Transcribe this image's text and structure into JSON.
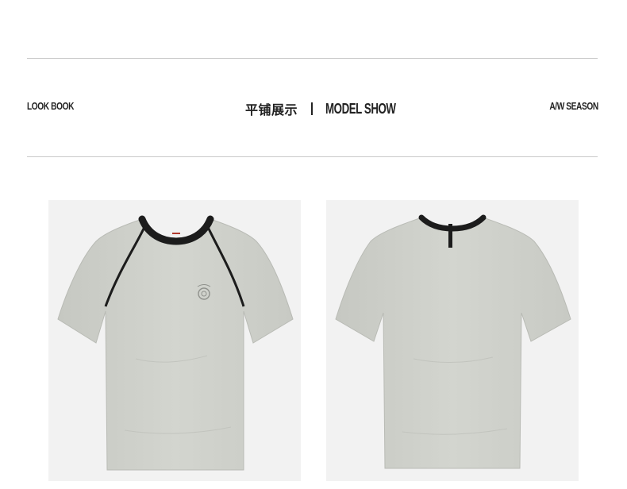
{
  "header": {
    "left_label": "LOOK BOOK",
    "center_cn": "平铺展示",
    "center_en": "MODEL SHOW",
    "right_label": "A/W SEASON"
  },
  "products": [
    {
      "view": "front",
      "color": "#cfd1cb",
      "trim_color": "#1c1c1c"
    },
    {
      "view": "back",
      "color": "#cfd1cb",
      "trim_color": "#1c1c1c"
    }
  ],
  "colors": {
    "background": "#ffffff",
    "rule": "#c9c9c9",
    "photo_bg": "#f2f2f2",
    "text": "#222222"
  }
}
